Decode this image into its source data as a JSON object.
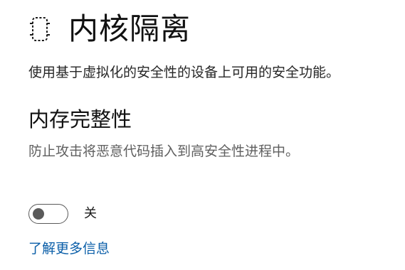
{
  "header": {
    "icon": "core-isolation-chip-icon",
    "title": "内核隔离"
  },
  "description": "使用基于虚拟化的安全性的设备上可用的安全功能。",
  "memory_integrity": {
    "title": "内存完整性",
    "description": "防止攻击将恶意代码插入到高安全性进程中。",
    "toggle": {
      "state": "off",
      "label": "关"
    }
  },
  "learn_more": {
    "label": "了解更多信息"
  },
  "colors": {
    "link": "#0a5ea8",
    "secondary_text": "#5f5f5f",
    "toggle_off": "#5a5a5a"
  }
}
